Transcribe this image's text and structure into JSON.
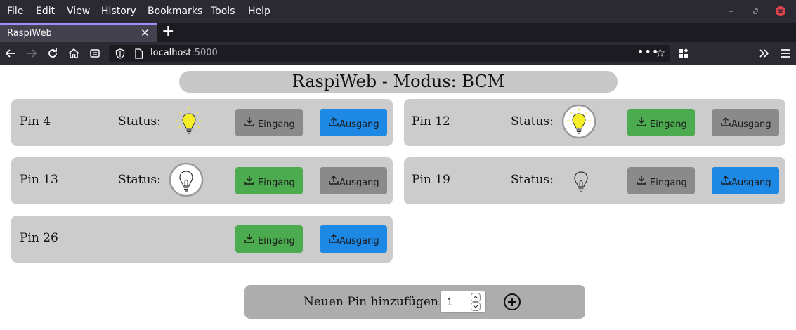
{
  "browser": {
    "menu": [
      "File",
      "Edit",
      "View",
      "History",
      "Bookmarks",
      "Tools",
      "Help"
    ],
    "tab_title": "RaspiWeb",
    "url_host": "localhost",
    "url_port": ":5000"
  },
  "page": {
    "title": "RaspiWeb - Modus: BCM",
    "status_label": "Status:",
    "btn_in": "Eingang",
    "btn_out": "Ausgang",
    "pins": [
      {
        "label": "Pin 4",
        "bulb": "lit",
        "in_color": "grey",
        "out_color": "blue"
      },
      {
        "label": "Pin 12",
        "bulb": "lit-circled",
        "in_color": "green",
        "out_color": "grey"
      },
      {
        "label": "Pin 13",
        "bulb": "off-circled",
        "in_color": "green",
        "out_color": "grey"
      },
      {
        "label": "Pin 19",
        "bulb": "off",
        "in_color": "grey",
        "out_color": "blue"
      },
      {
        "label": "Pin 26",
        "bulb": "none",
        "in_color": "green",
        "out_color": "blue"
      }
    ],
    "add_label": "Neuen Pin hinzufügen:",
    "add_value": "1"
  },
  "colors": {
    "green": "#4caa4f",
    "blue": "#1e88e5",
    "grey": "#8a8a8a",
    "card": "#cccccc"
  }
}
